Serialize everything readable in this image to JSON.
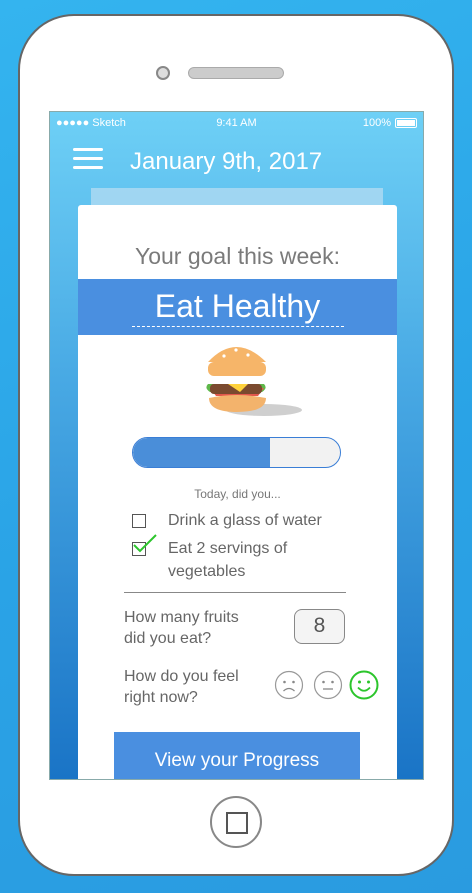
{
  "status_bar": {
    "carrier": "●●●●● Sketch",
    "time": "9:41 AM",
    "battery": "100%"
  },
  "header": {
    "date": "January 9th, 2017",
    "menu_icon": "hamburger-icon"
  },
  "goal": {
    "label": "Your goal this week:",
    "title": "Eat Healthy",
    "image_icon": "burger-icon"
  },
  "progress": {
    "fraction": 0.66
  },
  "checklist": {
    "prompt": "Today, did you...",
    "items": [
      {
        "line1": "Drink a glass of water",
        "line2": "",
        "checked": false
      },
      {
        "line1": "Eat 2 servings of",
        "line2": "vegetables",
        "checked": true
      }
    ]
  },
  "fruits": {
    "question_line1": "How many fruits",
    "question_line2": "did you eat?",
    "value": "8"
  },
  "mood": {
    "question_line1": "How do you feel",
    "question_line2": "right now?",
    "options": [
      "sad-face-icon",
      "neutral-face-icon",
      "happy-face-icon"
    ],
    "selected": "happy-face-icon",
    "accent": "#2cc52c"
  },
  "cta": {
    "label": "View your Progress"
  },
  "colors": {
    "accent": "#4a8fe0",
    "check": "#2cc52c"
  }
}
